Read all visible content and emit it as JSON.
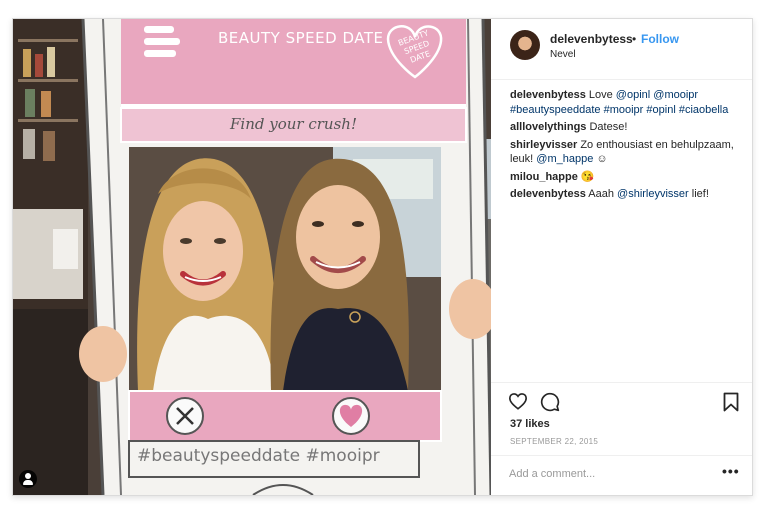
{
  "post": {
    "username": "delevenbytess",
    "separator": "•",
    "follow_label": "Follow",
    "location": "Nevel",
    "likes": "37 likes",
    "date": "SEPTEMBER 22, 2015",
    "add_comment_placeholder": "Add a comment...",
    "more_label": "•••"
  },
  "photo": {
    "frame_title": "BEAUTY SPEED DATE",
    "badge_text": [
      "BEAUTY",
      "SPEED",
      "DATE"
    ],
    "banner": "Find your crush!",
    "hashtags": "#beautyspeeddate #mooipr"
  },
  "comments": [
    {
      "user": "delevenbytess",
      "parts": [
        {
          "t": " Love ",
          "link": false
        },
        {
          "t": "@opinl",
          "link": true
        },
        {
          "t": " ",
          "link": false
        },
        {
          "t": "@mooipr",
          "link": true
        },
        {
          "t": " ",
          "link": false
        },
        {
          "t": "#beautyspeeddate",
          "link": true
        },
        {
          "t": " ",
          "link": false
        },
        {
          "t": "#mooipr",
          "link": true
        },
        {
          "t": " ",
          "link": false
        },
        {
          "t": "#opinl",
          "link": true
        },
        {
          "t": " ",
          "link": false
        },
        {
          "t": "#ciaobella",
          "link": true
        }
      ]
    },
    {
      "user": "alllovelythings",
      "parts": [
        {
          "t": " Datese!",
          "link": false
        }
      ]
    },
    {
      "user": "shirleyvisser",
      "parts": [
        {
          "t": " Zo enthousiast en behulpzaam, leuk! ",
          "link": false
        },
        {
          "t": "@m_happe",
          "link": true
        },
        {
          "t": " ☺",
          "link": false
        }
      ]
    },
    {
      "user": "milou_happe",
      "parts": [
        {
          "t": " 😘",
          "link": false
        }
      ]
    },
    {
      "user": "delevenbytess",
      "parts": [
        {
          "t": " Aaah ",
          "link": false
        },
        {
          "t": "@shirleyvisser",
          "link": true
        },
        {
          "t": " lief!",
          "link": false
        }
      ]
    }
  ],
  "icons": {
    "like": "heart-icon",
    "comment": "comment-bubble-icon",
    "save": "bookmark-icon",
    "tag": "user-tag-icon"
  },
  "colors": {
    "follow": "#3897f0",
    "link": "#003569",
    "frame_pink": "#e9a7bf"
  }
}
